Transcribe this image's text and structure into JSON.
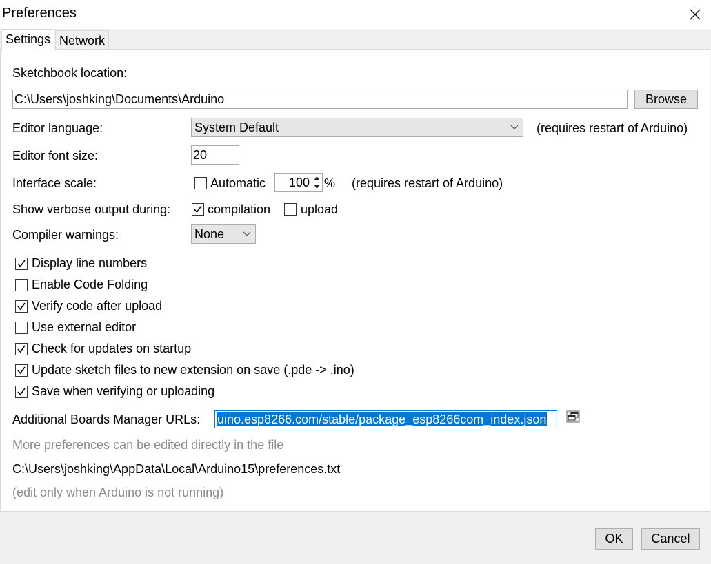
{
  "window": {
    "title": "Preferences"
  },
  "tabs": [
    {
      "label": "Settings",
      "active": true
    },
    {
      "label": "Network",
      "active": false
    }
  ],
  "sketchbook": {
    "label": "Sketchbook location:",
    "value": "C:\\Users\\joshking\\Documents\\Arduino",
    "browse_label": "Browse"
  },
  "editor_language": {
    "label": "Editor language:",
    "value": "System Default",
    "note": "(requires restart of Arduino)"
  },
  "font_size": {
    "label": "Editor font size:",
    "value": "20"
  },
  "interface_scale": {
    "label": "Interface scale:",
    "automatic_label": "Automatic",
    "automatic_checked": false,
    "value": "100",
    "unit": "%",
    "note": "(requires restart of Arduino)"
  },
  "verbose": {
    "label": "Show verbose output during:",
    "compilation_label": "compilation",
    "compilation_checked": true,
    "upload_label": "upload",
    "upload_checked": false
  },
  "compiler_warnings": {
    "label": "Compiler warnings:",
    "value": "None"
  },
  "options": [
    {
      "label": "Display line numbers",
      "checked": true
    },
    {
      "label": "Enable Code Folding",
      "checked": false
    },
    {
      "label": "Verify code after upload",
      "checked": true
    },
    {
      "label": "Use external editor",
      "checked": false
    },
    {
      "label": "Check for updates on startup",
      "checked": true
    },
    {
      "label": "Update sketch files to new extension on save (.pde -> .ino)",
      "checked": true
    },
    {
      "label": "Save when verifying or uploading",
      "checked": true
    }
  ],
  "boards_urls": {
    "label": "Additional Boards Manager URLs:",
    "value": "uino.esp8266.com/stable/package_esp8266com_index.json"
  },
  "footer_notes": {
    "more_prefs": "More preferences can be edited directly in the file",
    "path": "C:\\Users\\joshking\\AppData\\Local\\Arduino15\\preferences.txt",
    "edit_note": "(edit only when Arduino is not running)"
  },
  "buttons": {
    "ok": "OK",
    "cancel": "Cancel"
  },
  "colors": {
    "selection": "#0078d7",
    "panel": "#ffffff",
    "chrome": "#f0f0f0"
  },
  "icons": {
    "close": "close-icon",
    "expand": "expand-window-icon",
    "check": "check-icon",
    "dropdown": "chevron-down-icon"
  }
}
